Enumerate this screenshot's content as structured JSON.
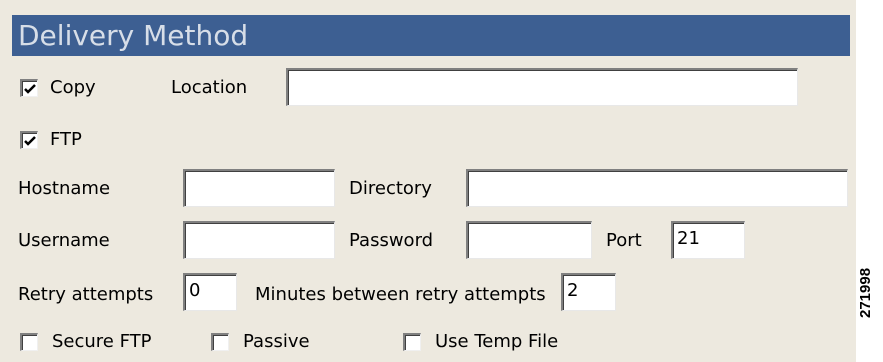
{
  "section": {
    "title": "Delivery Method"
  },
  "copy": {
    "label": "Copy",
    "checked": true
  },
  "location": {
    "label": "Location",
    "value": ""
  },
  "ftp": {
    "label": "FTP",
    "checked": true
  },
  "hostname": {
    "label": "Hostname",
    "value": ""
  },
  "directory": {
    "label": "Directory",
    "value": ""
  },
  "username": {
    "label": "Username",
    "value": ""
  },
  "password": {
    "label": "Password",
    "value": ""
  },
  "port": {
    "label": "Port",
    "value": "21"
  },
  "retry": {
    "label": "Retry attempts",
    "value": "0"
  },
  "minutes": {
    "label": "Minutes between retry attempts",
    "value": "2"
  },
  "options": {
    "secure_ftp": {
      "label": "Secure FTP",
      "checked": false
    },
    "passive": {
      "label": "Passive",
      "checked": false
    },
    "temp_file": {
      "label": "Use Temp File",
      "checked": false
    }
  },
  "figure_id": "271998",
  "colors": {
    "header_bg": "#3d5f92",
    "header_text": "#d7dee8",
    "panel_bg": "#ede9df"
  }
}
